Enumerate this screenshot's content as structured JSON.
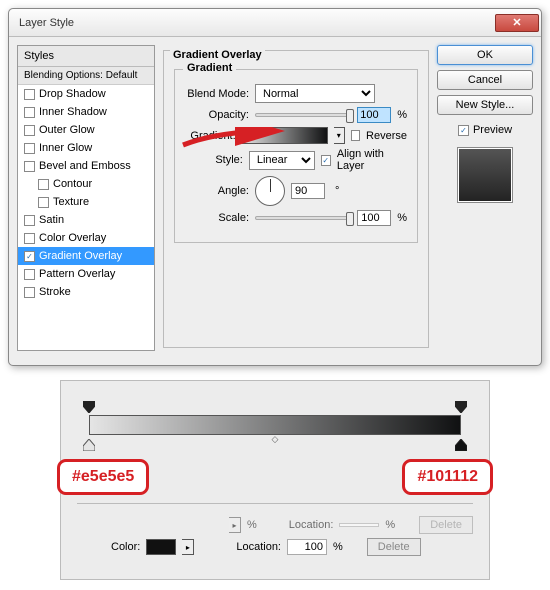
{
  "dialog": {
    "title": "Layer Style",
    "close_glyph": "✕"
  },
  "styles_panel": {
    "header": "Styles",
    "blending_header": "Blending Options: Default",
    "items": [
      {
        "label": "Drop Shadow",
        "checked": false,
        "indent": false
      },
      {
        "label": "Inner Shadow",
        "checked": false,
        "indent": false
      },
      {
        "label": "Outer Glow",
        "checked": false,
        "indent": false
      },
      {
        "label": "Inner Glow",
        "checked": false,
        "indent": false
      },
      {
        "label": "Bevel and Emboss",
        "checked": false,
        "indent": false
      },
      {
        "label": "Contour",
        "checked": false,
        "indent": true
      },
      {
        "label": "Texture",
        "checked": false,
        "indent": true
      },
      {
        "label": "Satin",
        "checked": false,
        "indent": false
      },
      {
        "label": "Color Overlay",
        "checked": false,
        "indent": false
      },
      {
        "label": "Gradient Overlay",
        "checked": true,
        "indent": false,
        "selected": true
      },
      {
        "label": "Pattern Overlay",
        "checked": false,
        "indent": false
      },
      {
        "label": "Stroke",
        "checked": false,
        "indent": false
      }
    ]
  },
  "overlay": {
    "group_title": "Gradient Overlay",
    "subgroup_title": "Gradient",
    "blend_mode_label": "Blend Mode:",
    "blend_mode_value": "Normal",
    "opacity_label": "Opacity:",
    "opacity_value": "100",
    "percent": "%",
    "gradient_label": "Gradient:",
    "reverse_label": "Reverse",
    "reverse_checked": false,
    "style_label": "Style:",
    "style_value": "Linear",
    "align_label": "Align with Layer",
    "align_checked": true,
    "angle_label": "Angle:",
    "angle_value": "90",
    "degree": "°",
    "scale_label": "Scale:",
    "scale_value": "100"
  },
  "buttons": {
    "ok": "OK",
    "cancel": "Cancel",
    "new_style": "New Style...",
    "preview_label": "Preview",
    "preview_checked": true
  },
  "gradient_editor": {
    "left_hex": "#e5e5e5",
    "right_hex": "#101112",
    "pct": "%",
    "location_label": "Location:",
    "color_label": "Color:",
    "location_value": "100",
    "delete_label": "Delete",
    "dd_glyph": "▸"
  },
  "glyphs": {
    "check": "✓",
    "dd": "▾"
  }
}
